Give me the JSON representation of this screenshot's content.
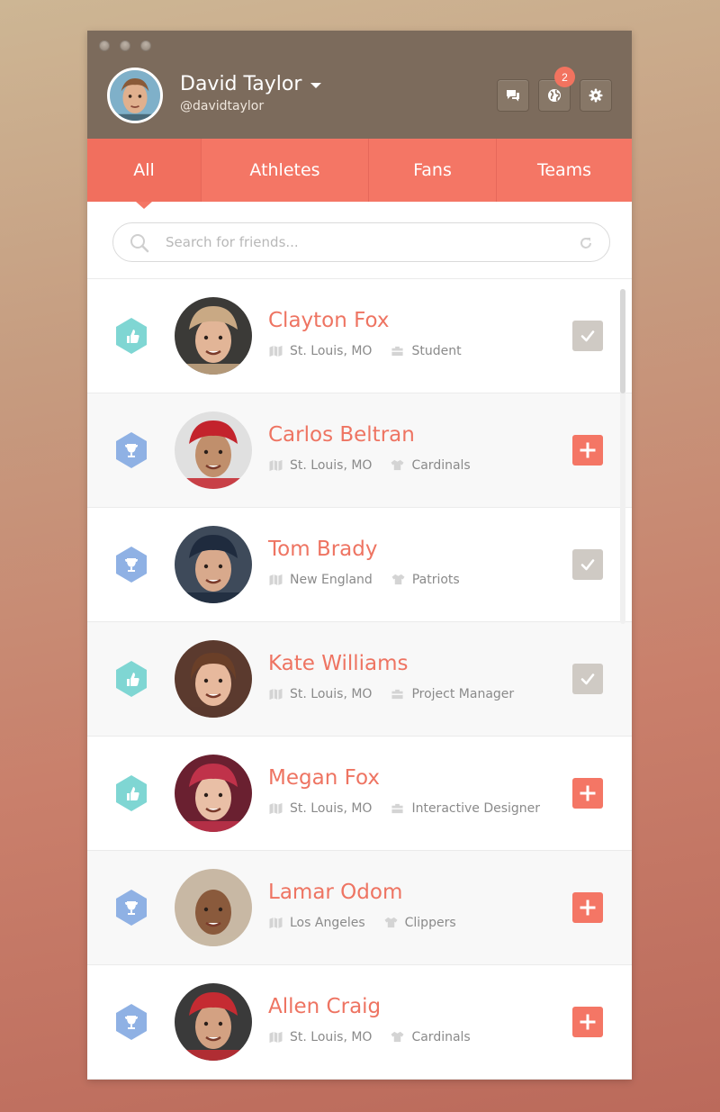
{
  "window": {
    "traffic_lights": 3
  },
  "user": {
    "name": "David Taylor",
    "handle": "@davidtaylor"
  },
  "header": {
    "buttons": [
      {
        "name": "messages",
        "icon": "chat-icon"
      },
      {
        "name": "notifications",
        "icon": "globe-icon",
        "badge": "2"
      },
      {
        "name": "settings",
        "icon": "gear-icon"
      }
    ]
  },
  "tabs": [
    {
      "label": "All",
      "active": true
    },
    {
      "label": "Athletes",
      "active": false
    },
    {
      "label": "Fans",
      "active": false
    },
    {
      "label": "Teams",
      "active": false
    }
  ],
  "search": {
    "placeholder": "Search for friends..."
  },
  "people": [
    {
      "name": "Clayton Fox",
      "location": "St. Louis, MO",
      "detail": "Student",
      "detail_icon": "briefcase-icon",
      "type_icon": "thumbs-up-icon",
      "type_color": "#7fd6d3",
      "action": "added"
    },
    {
      "name": "Carlos Beltran",
      "location": "St. Louis, MO",
      "detail": "Cardinals",
      "detail_icon": "jersey-icon",
      "type_icon": "trophy-icon",
      "type_color": "#8fb1e4",
      "action": "add"
    },
    {
      "name": "Tom Brady",
      "location": "New England",
      "detail": "Patriots",
      "detail_icon": "jersey-icon",
      "type_icon": "trophy-icon",
      "type_color": "#8fb1e4",
      "action": "added"
    },
    {
      "name": "Kate Williams",
      "location": "St. Louis, MO",
      "detail": "Project Manager",
      "detail_icon": "briefcase-icon",
      "type_icon": "thumbs-up-icon",
      "type_color": "#7fd6d3",
      "action": "added"
    },
    {
      "name": "Megan Fox",
      "location": "St. Louis, MO",
      "detail": "Interactive Designer",
      "detail_icon": "briefcase-icon",
      "type_icon": "thumbs-up-icon",
      "type_color": "#7fd6d3",
      "action": "add"
    },
    {
      "name": "Lamar Odom",
      "location": "Los Angeles",
      "detail": "Clippers",
      "detail_icon": "jersey-icon",
      "type_icon": "trophy-icon",
      "type_color": "#8fb1e4",
      "action": "add"
    },
    {
      "name": "Allen Craig",
      "location": "St. Louis, MO",
      "detail": "Cardinals",
      "detail_icon": "jersey-icon",
      "type_icon": "trophy-icon",
      "type_color": "#8fb1e4",
      "action": "add"
    }
  ],
  "colors": {
    "accent": "#f47665",
    "header_bg": "#7c6b5c",
    "name_text": "#ee7462",
    "added_bg": "#cfcac4"
  }
}
